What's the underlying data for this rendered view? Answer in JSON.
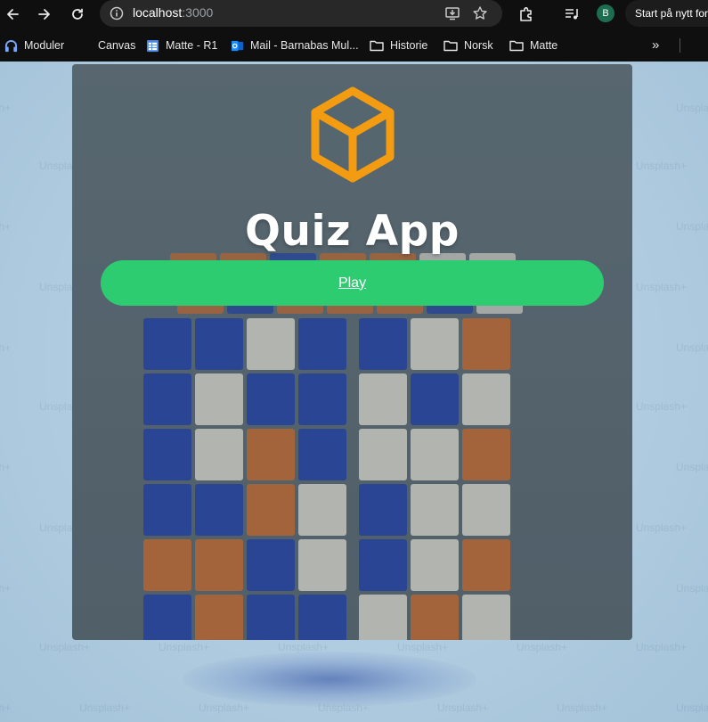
{
  "browser": {
    "url_host": "localhost",
    "url_port": ":3000",
    "profile_initial": "B",
    "restart_label": "Start på nytt for å oppdatere",
    "bookmarks": [
      {
        "label": "Moduler",
        "icon": "headset-icon"
      },
      {
        "label": "Canvas",
        "icon": "canvas-icon"
      },
      {
        "label": "Matte - R1",
        "icon": "sheet-icon"
      },
      {
        "label": "Mail - Barnabas Mul...",
        "icon": "outlook-icon"
      },
      {
        "label": "Historie",
        "icon": "folder-icon"
      },
      {
        "label": "Norsk",
        "icon": "folder-icon"
      },
      {
        "label": "Matte",
        "icon": "folder-icon"
      }
    ],
    "more_label": "»"
  },
  "background": {
    "watermark_text": "Unsplash+"
  },
  "app": {
    "title": "Quiz App",
    "play_label": "Play",
    "logo_icon": "box-icon",
    "colors": {
      "accent": "#f39c12",
      "play_button": "#2ecc71",
      "card": "#5b6973"
    }
  }
}
